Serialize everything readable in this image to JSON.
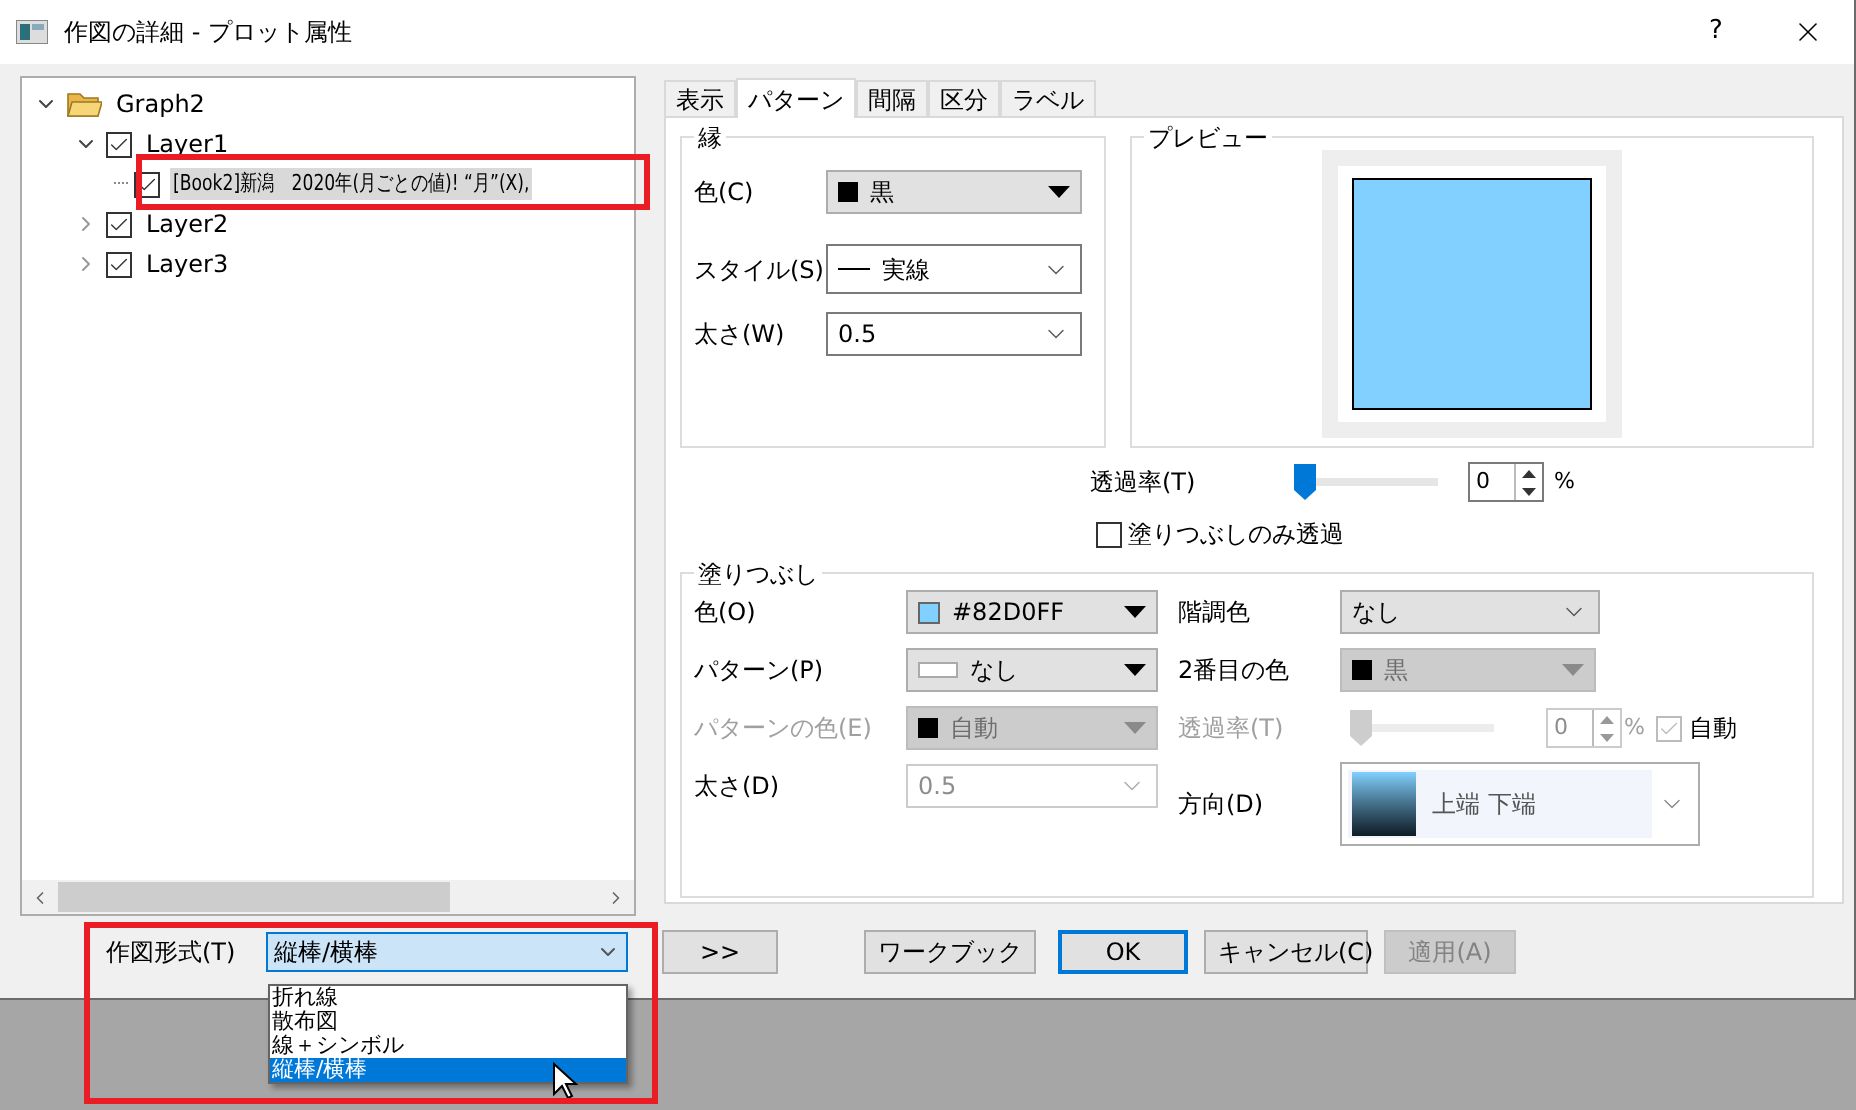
{
  "window": {
    "title": "作図の詳細 - プロット属性",
    "help": "?"
  },
  "tree": [
    {
      "label": "Graph2",
      "expanded": true,
      "children": [
        {
          "label": "Layer1",
          "checked": true,
          "expanded": true,
          "selected": false,
          "children": [
            {
              "label": "[Book2]新潟　2020年(月ごとの値)! “月”(X),",
              "checked": true,
              "selected": true
            }
          ]
        },
        {
          "label": "Layer2",
          "checked": true,
          "expanded": false,
          "selected": false
        },
        {
          "label": "Layer3",
          "checked": true,
          "expanded": false,
          "selected": false
        }
      ]
    }
  ],
  "tabs": [
    {
      "label": "表示",
      "selected": false
    },
    {
      "label": "パターン",
      "selected": true
    },
    {
      "label": "間隔",
      "selected": false
    },
    {
      "label": "区分",
      "selected": false
    },
    {
      "label": "ラベル",
      "selected": false
    }
  ],
  "border_group": {
    "title": "縁",
    "color": {
      "label": "色(C)",
      "value": "黒"
    },
    "style": {
      "label": "スタイル(S)",
      "value": "実線"
    },
    "width": {
      "label": "太さ(W)",
      "value": "0.5"
    }
  },
  "preview": {
    "title": "プレビュー"
  },
  "transparency": {
    "label": "透過率(T)",
    "level": 0,
    "value": "0",
    "unit": "%"
  },
  "fill_only": {
    "label": "塗りつぶしのみ透過",
    "checked": false
  },
  "fill_group": {
    "title": "塗りつぶし",
    "color": {
      "label": "色(O)",
      "value": "#82D0FF",
      "disabled": false
    },
    "pattern": {
      "label": "パターン(P)",
      "value": "なし",
      "disabled": false
    },
    "pattern_color": {
      "label": "パターンの色(E)",
      "value": "自動",
      "disabled": true
    },
    "width": {
      "label": "太さ(D)",
      "value": "0.5",
      "disabled": true
    },
    "gradient": {
      "label": "階調色",
      "value": "なし",
      "disabled": false
    },
    "second_color": {
      "label": "2番目の色",
      "value": "黒",
      "disabled": true
    },
    "transparency": {
      "label": "透過率(T)",
      "level": 0,
      "value": "0",
      "unit": "%",
      "disabled": true,
      "auto": {
        "label": "自動",
        "checked": true
      }
    },
    "direction": {
      "label": "方向(D)",
      "value": "上端 下端"
    }
  },
  "plot_type": {
    "label": "作図形式(T)",
    "value": "縦棒/横棒",
    "options": [
      {
        "label": "折れ線",
        "selected": false
      },
      {
        "label": "散布図",
        "selected": false
      },
      {
        "label": "線＋シンボル",
        "selected": false
      },
      {
        "label": "縦棒/横棒",
        "selected": true
      }
    ]
  },
  "buttons": [
    {
      "label": ">>",
      "default": false,
      "disabled": false
    },
    {
      "label": "ワークブック",
      "default": false,
      "disabled": false
    },
    {
      "label": "OK",
      "default": true,
      "disabled": false
    },
    {
      "label": "キャンセル(C)",
      "default": false,
      "disabled": false
    },
    {
      "label": "適用(A)",
      "default": false,
      "disabled": true
    }
  ]
}
